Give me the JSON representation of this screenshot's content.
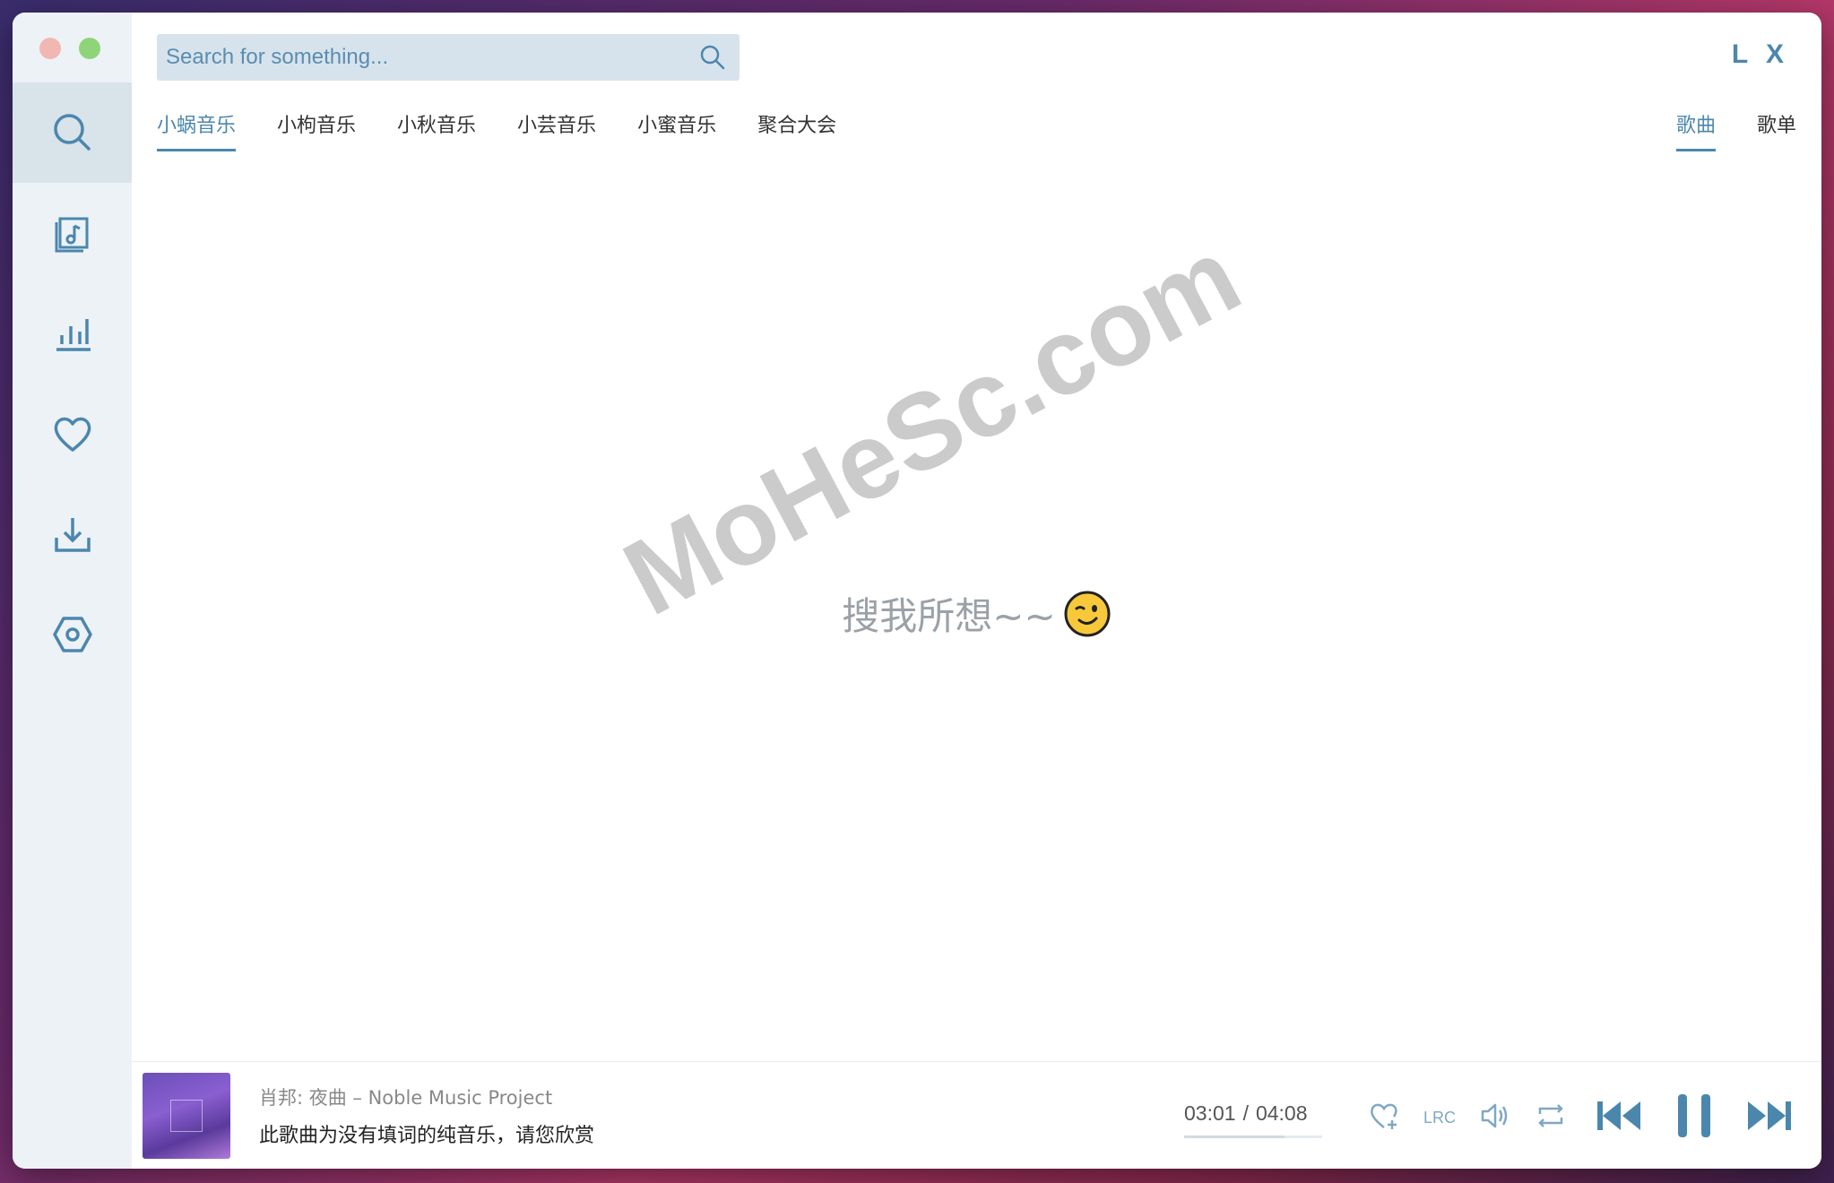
{
  "app": {
    "logo": "L X"
  },
  "search": {
    "placeholder": "Search for something..."
  },
  "sidebar": {
    "items": [
      {
        "icon": "search-icon",
        "active": true
      },
      {
        "icon": "playlist-music-icon"
      },
      {
        "icon": "leaderboard-icon"
      },
      {
        "icon": "heart-icon"
      },
      {
        "icon": "download-icon"
      },
      {
        "icon": "settings-hex-icon"
      }
    ]
  },
  "source_tabs": [
    "小蜗音乐",
    "小枸音乐",
    "小秋音乐",
    "小芸音乐",
    "小蜜音乐",
    "聚合大会"
  ],
  "type_tabs": [
    "歌曲",
    "歌单"
  ],
  "empty_state": {
    "text": "搜我所想~~"
  },
  "watermark": "MoHeSc.com",
  "player": {
    "title": "肖邦: 夜曲 – Noble Music Project",
    "lyric": "此歌曲为没有填词的纯音乐，请您欣赏",
    "current_time": "03:01",
    "separator": "/",
    "total_time": "04:08",
    "progress": 0.73,
    "accent": "#4b87ad"
  }
}
